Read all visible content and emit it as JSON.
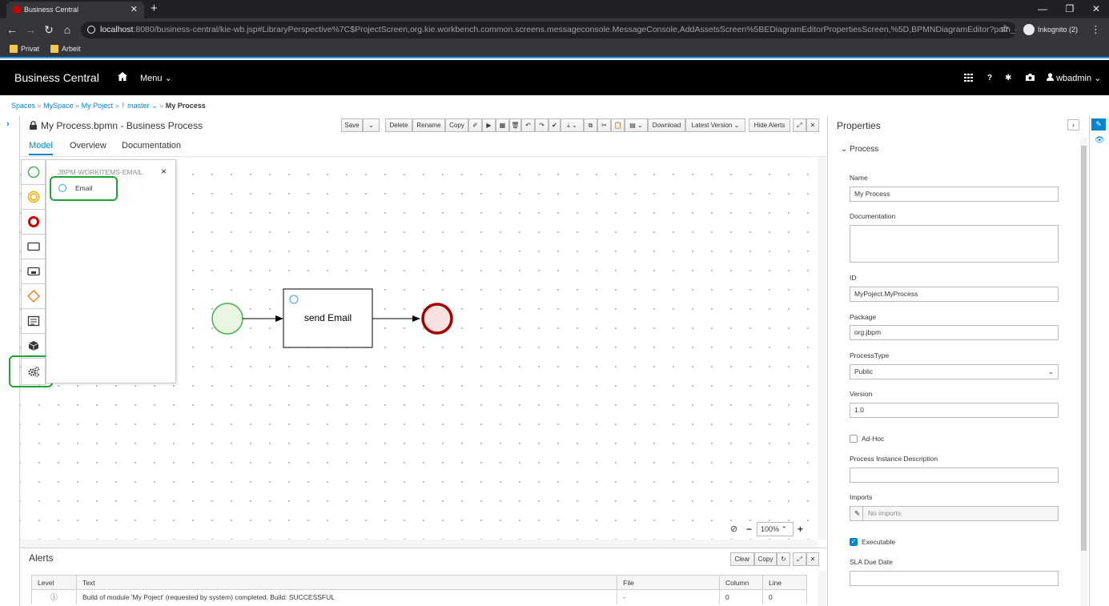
{
  "browser": {
    "tab_title": "Business Central",
    "tab_close": "✕",
    "new_tab": "+",
    "url_host": "localhost",
    "url_rest": ":8080/business-central/kie-wb.jsp#LibraryPerspective%7C$ProjectScreen,org.kie.workbench.common.screens.messageconsole.MessageConsole,AddAssetsScreen%5BEDiagramEditorPropertiesScreen,%5D,BPMNDiagramEditor?path_uri=defau...",
    "incognito_label": "Inkognito (2)",
    "bookmarks": [
      "Privat",
      "Arbeit"
    ]
  },
  "app": {
    "brand": "Business Central",
    "menu_label": "Menu",
    "user": "wbadmin"
  },
  "breadcrumb": {
    "items": [
      "Spaces",
      "MySpace",
      "My Poject",
      "master"
    ],
    "current": "My Process",
    "sep": "»"
  },
  "editor": {
    "title": "My Process.bpmn - Business Process",
    "toolbar": {
      "save": "Save",
      "delete": "Delete",
      "rename": "Rename",
      "copy": "Copy",
      "download": "Download",
      "latest_version": "Latest Version",
      "hide_alerts": "Hide Alerts"
    },
    "tabs": [
      "Model",
      "Overview",
      "Documentation"
    ],
    "active_tab": "Model"
  },
  "palette": {
    "flyout_title": "JBPM-WORKITEMS-EMAIL",
    "flyout_item": "Email",
    "flyout_close": "×"
  },
  "diagram": {
    "task_label": "send Email"
  },
  "zoom": {
    "level": "100%"
  },
  "properties": {
    "title": "Properties",
    "section": "Process",
    "fields": {
      "name_label": "Name",
      "name_value": "My Process",
      "doc_label": "Documentation",
      "doc_value": "",
      "id_label": "ID",
      "id_value": "MyPoject.MyProcess",
      "package_label": "Package",
      "package_value": "org.jbpm",
      "process_type_label": "ProcessType",
      "process_type_value": "Public",
      "version_label": "Version",
      "version_value": "1.0",
      "adhoc_label": "Ad-Hoc",
      "adhoc_checked": false,
      "instance_desc_label": "Process Instance Description",
      "instance_desc_value": "",
      "imports_label": "Imports",
      "imports_value": "No imports",
      "executable_label": "Executable",
      "executable_checked": true,
      "sla_label": "SLA Due Date",
      "sla_value": ""
    }
  },
  "alerts": {
    "title": "Alerts",
    "clear": "Clear",
    "copy": "Copy",
    "columns": [
      "Level",
      "Text",
      "File",
      "Column",
      "Line"
    ],
    "rows": [
      {
        "level": "ⓘ",
        "text": "Build of module 'My Poject' (requested by system) completed. Build: SUCCESSFUL",
        "file": "-",
        "column": "0",
        "line": "0"
      }
    ]
  },
  "colors": {
    "accent": "#0088ce",
    "highlight": "#22a33a",
    "start_event": "#4caf50",
    "end_event": "#a30000"
  }
}
